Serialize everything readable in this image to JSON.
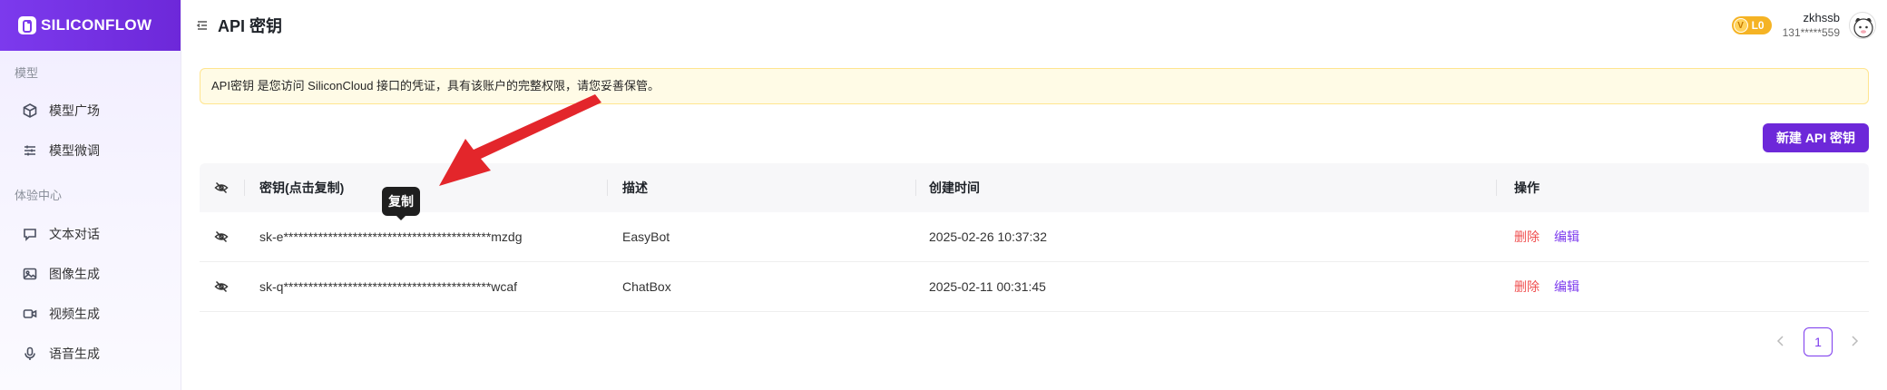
{
  "brand": {
    "name": "SILICONFLOW"
  },
  "sidebar": {
    "sections": [
      {
        "label": "模型",
        "items": [
          {
            "label": "模型广场",
            "icon": "cube-icon"
          },
          {
            "label": "模型微调",
            "icon": "sliders-icon"
          }
        ]
      },
      {
        "label": "体验中心",
        "items": [
          {
            "label": "文本对话",
            "icon": "chat-bubble-icon"
          },
          {
            "label": "图像生成",
            "icon": "image-icon"
          },
          {
            "label": "视频生成",
            "icon": "video-camera-icon"
          },
          {
            "label": "语音生成",
            "icon": "microphone-icon"
          }
        ]
      }
    ]
  },
  "header": {
    "title": "API 密钥",
    "level_badge": "L0",
    "level_badge_letter": "V",
    "username": "zkhssb",
    "phone": "131*****559"
  },
  "notice": {
    "text": "API密钥 是您访问 SiliconCloud 接口的凭证，具有该账户的完整权限，请您妥善保管。"
  },
  "actions": {
    "new_key_label": "新建 API 密钥"
  },
  "table": {
    "columns": [
      "密钥(点击复制)",
      "描述",
      "创建时间",
      "操作"
    ],
    "rows": [
      {
        "key": "sk-e******************************************mzdg",
        "description": "EasyBot",
        "created": "2025-02-26 10:37:32",
        "delete": "删除",
        "edit": "编辑"
      },
      {
        "key": "sk-q******************************************wcaf",
        "description": "ChatBox",
        "created": "2025-02-11 00:31:45",
        "delete": "删除",
        "edit": "编辑"
      }
    ]
  },
  "tooltip": {
    "text": "复制"
  },
  "pagination": {
    "current": "1"
  },
  "colors": {
    "brand": "#6d28d9",
    "danger": "#f04f4f",
    "annotation_arrow": "#e3262b",
    "badge": "#f5b324"
  }
}
